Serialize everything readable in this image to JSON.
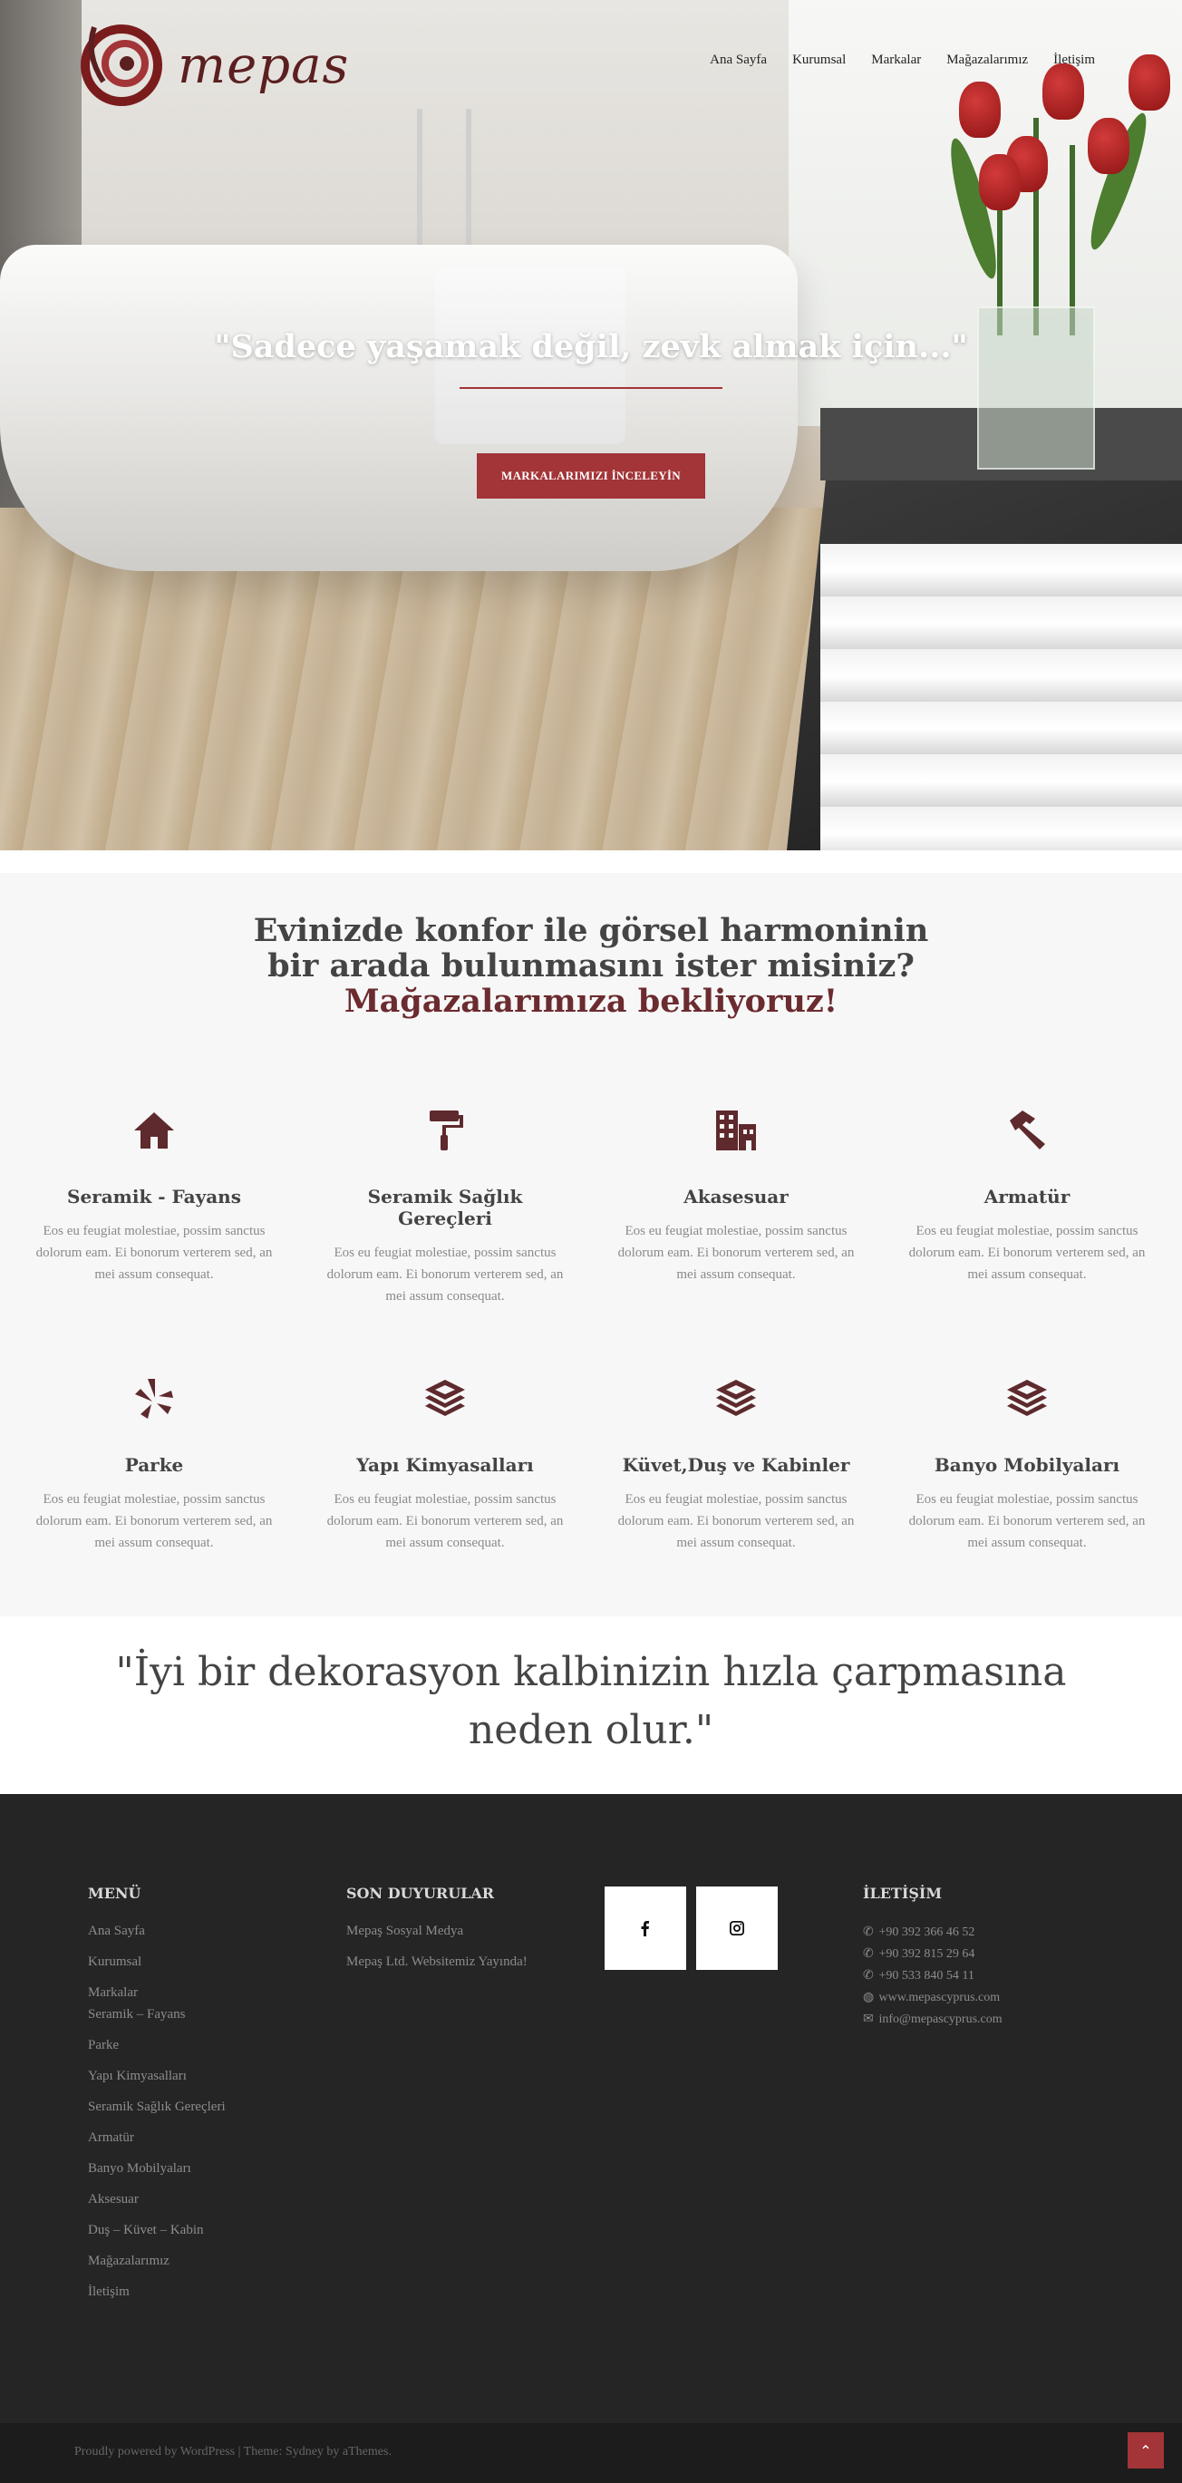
{
  "brand": {
    "name": "mepas",
    "accent": "#a33437",
    "icon_dark": "#5e2a2d"
  },
  "nav": [
    "Ana Sayfa",
    "Kurumsal",
    "Markalar",
    "Mağazalarımız",
    "İletişim"
  ],
  "hero": {
    "quote": "\"Sadece yaşamak değil, zevk almak için...\"",
    "button": "MARKALARIMIZI İNCELEYİN"
  },
  "services": {
    "title_line1": "Evinizde konfor ile görsel harmoninin",
    "title_line2": "bir arada bulunmasını ister misiniz?",
    "title_accent": "Mağazalarımıza bekliyoruz!",
    "items": [
      {
        "title": "Seramik - Fayans",
        "icon": "home-icon",
        "text": "Eos eu feugiat molestiae, possim sanctus dolorum eam. Ei bonorum verterem sed, an mei assum consequat."
      },
      {
        "title": "Seramik Sağlık Gereçleri",
        "icon": "paint-roller-icon",
        "text": "Eos eu feugiat molestiae, possim sanctus dolorum eam. Ei bonorum verterem sed, an mei assum consequat."
      },
      {
        "title": "Akasesuar",
        "icon": "building-icon",
        "text": "Eos eu feugiat molestiae, possim sanctus dolorum eam. Ei bonorum verterem sed, an mei assum consequat."
      },
      {
        "title": "Armatür",
        "icon": "hammer-icon",
        "text": "Eos eu feugiat molestiae, possim sanctus dolorum eam. Ei bonorum verterem sed, an mei assum consequat."
      },
      {
        "title": "Parke",
        "icon": "yelp-icon",
        "text": "Eos eu feugiat molestiae, possim sanctus dolorum eam. Ei bonorum verterem sed, an mei assum consequat."
      },
      {
        "title": "Yapı Kimyasalları",
        "icon": "layers-icon",
        "text": "Eos eu feugiat molestiae, possim sanctus dolorum eam. Ei bonorum verterem sed, an mei assum consequat."
      },
      {
        "title": "Küvet,Duş ve Kabinler",
        "icon": "layers-icon",
        "text": "Eos eu feugiat molestiae, possim sanctus dolorum eam. Ei bonorum verterem sed, an mei assum consequat."
      },
      {
        "title": "Banyo Mobilyaları",
        "icon": "layers-icon",
        "text": "Eos eu feugiat molestiae, possim sanctus dolorum eam. Ei bonorum verterem sed, an mei assum consequat."
      }
    ]
  },
  "quote_band": {
    "line1": "\"İyi bir dekorasyon kalbinizin hızla çarpmasına",
    "line2": "neden olur.\""
  },
  "footer": {
    "menu_title": "MENÜ",
    "menu": [
      "Ana Sayfa",
      "Kurumsal",
      "Markalar",
      "Seramik – Fayans",
      "Parke",
      "Yapı Kimyasalları",
      "Seramik Sağlık Gereçleri",
      "Armatür",
      "Banyo Mobilyaları",
      "Aksesuar",
      "Duş – Küvet – Kabin",
      "Mağazalarımız",
      "İletişim"
    ],
    "news_title": "SON DUYURULAR",
    "news": [
      "Mepaş Sosyal Medya",
      "Mepaş Ltd. Websitemiz Yayında!"
    ],
    "contact_title": "İLETİŞİM",
    "phones": [
      "+90 392 366 46 52",
      "+90 392 815 29 64",
      "+90 533 840 54 11"
    ],
    "website": "www.mepascyprus.com",
    "email": "info@mepascyprus.com",
    "credits": "Proudly powered by WordPress | Theme: Sydney by aThemes."
  }
}
